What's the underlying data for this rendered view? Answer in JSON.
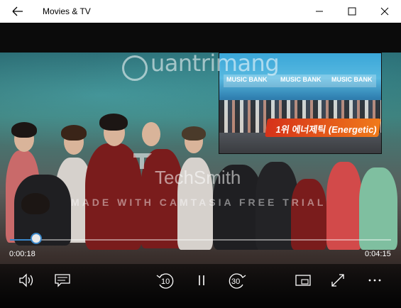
{
  "window": {
    "title": "Movies & TV",
    "back_icon": "back-arrow-icon",
    "minimize_icon": "minimize-icon",
    "maximize_icon": "maximize-icon",
    "close_icon": "close-icon"
  },
  "watermarks": {
    "site": "uantrimang",
    "techsmith": "TechSmith",
    "trial_notice": "MADE WITH CAMTASIA FREE TRIAL"
  },
  "pip": {
    "sign_1": "MUSIC BANK",
    "sign_2": "MUSIC BANK",
    "sign_3": "MUSIC BANK",
    "banner": "1위 에너제틱 (Energetic)"
  },
  "player": {
    "current_time": "0:00:18",
    "duration": "0:04:15",
    "progress_fraction": 0.07,
    "accent_color": "#3a86c8",
    "skip_back_label": "10",
    "skip_forward_label": "30",
    "buttons": {
      "volume_icon": "volume-icon",
      "captions_icon": "captions-icon",
      "skip_back_icon": "skip-back-icon",
      "pause_icon": "pause-icon",
      "skip_forward_icon": "skip-forward-icon",
      "mini_view_icon": "mini-view-icon",
      "fullscreen_icon": "fullscreen-icon",
      "more_icon": "more-icon"
    }
  }
}
